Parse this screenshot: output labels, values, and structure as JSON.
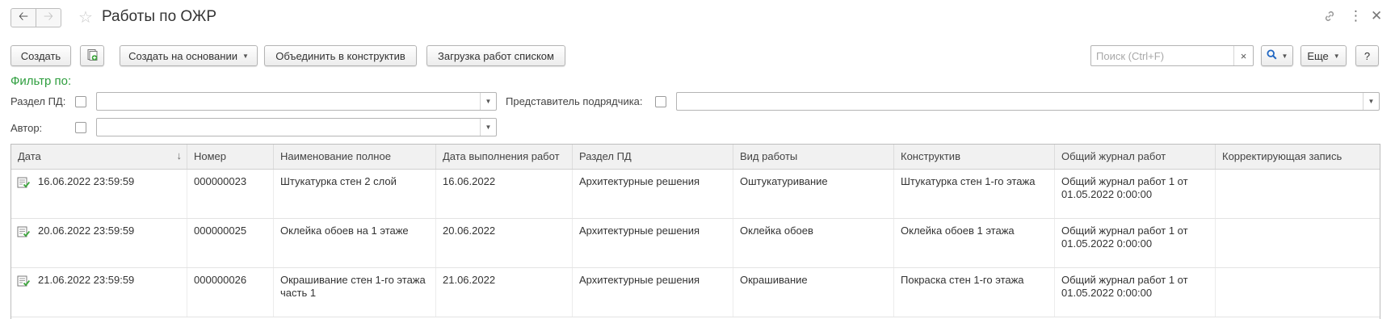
{
  "window": {
    "title": "Работы по ОЖР",
    "icons": [
      "arrow-left-icon",
      "arrow-right-icon",
      "star-icon",
      "link-icon",
      "more-vertical-icon",
      "close-icon"
    ]
  },
  "toolbar": {
    "create_label": "Создать",
    "create_based_label": "Создать на основании",
    "merge_label": "Объединить в конструктив",
    "load_list_label": "Загрузка работ списком",
    "search_placeholder": "Поиск (Ctrl+F)",
    "search_value": "",
    "more_label": "Еще",
    "help_label": "?"
  },
  "filter": {
    "header": "Фильтр по:",
    "section_label": "Раздел ПД:",
    "section_checked": false,
    "section_value": "",
    "contractor_label": "Представитель подрядчика:",
    "contractor_checked": false,
    "contractor_value": "",
    "author_label": "Автор:",
    "author_checked": false,
    "author_value": ""
  },
  "table": {
    "columns": [
      "Дата",
      "Номер",
      "Наименование полное",
      "Дата выполнения работ",
      "Раздел ПД",
      "Вид работы",
      "Конструктив",
      "Общий журнал работ",
      "Корректирующая запись"
    ],
    "sorted_column": "Дата",
    "sort_direction": "descending",
    "rows": [
      {
        "date": "16.06.2022 23:59:59",
        "number": "000000023",
        "name": "Штукатурка стен 2 слой",
        "done_date": "16.06.2022",
        "section": "Архитектурные решения",
        "work_type": "Оштукатуривание",
        "construct": "Штукатурка стен 1-го этажа",
        "journal_line1": "Общий журнал работ 1 от",
        "journal_line2": "01.05.2022 0:00:00",
        "correction": ""
      },
      {
        "date": "20.06.2022 23:59:59",
        "number": "000000025",
        "name": "Оклейка обоев на 1 этаже",
        "done_date": "20.06.2022",
        "section": "Архитектурные решения",
        "work_type": "Оклейка обоев",
        "construct": "Оклейка обоев 1 этажа",
        "journal_line1": "Общий журнал работ 1 от",
        "journal_line2": "01.05.2022 0:00:00",
        "correction": ""
      },
      {
        "date": "21.06.2022 23:59:59",
        "number": "000000026",
        "name": "Окрашивание стен 1-го этажа часть 1",
        "done_date": "21.06.2022",
        "section": "Архитектурные решения",
        "work_type": "Окрашивание",
        "construct": "Покраска стен 1-го этажа",
        "journal_line1": "Общий журнал работ 1 от",
        "journal_line2": "01.05.2022 0:00:00",
        "correction": ""
      }
    ]
  },
  "colors": {
    "filter_header": "#2e9e3e",
    "search_button_icon": "#1f66c2",
    "doc_icon_accent": "#3aa53a"
  }
}
